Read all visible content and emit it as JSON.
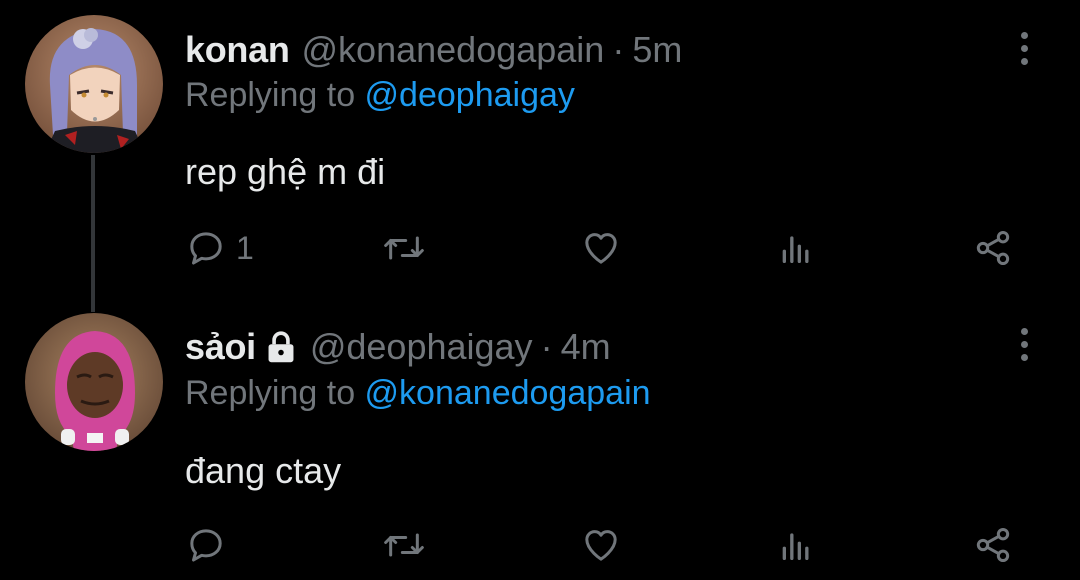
{
  "tweets": [
    {
      "name": "konan",
      "handle": "@konanedogapain",
      "separator": "·",
      "time": "5m",
      "reply_prefix": "Replying to",
      "reply_to": "@deophaigay",
      "text": "rep ghệ m đi",
      "reply_count": "1",
      "protected": false,
      "avatar": "anime-character-avatar"
    },
    {
      "name": "sảoi",
      "handle": "@deophaigay",
      "separator": "·",
      "time": "4m",
      "reply_prefix": "Replying to",
      "reply_to": "@konanedogapain",
      "text": "đang ctay",
      "reply_count": "",
      "protected": true,
      "avatar": "pink-hooded-character-avatar"
    }
  ],
  "colors": {
    "background": "#000000",
    "primary_text": "#e7e9ea",
    "secondary_text": "#71767b",
    "link": "#1d9bf0",
    "thread_line": "#333639"
  },
  "icons": [
    "reply-icon",
    "retweet-icon",
    "like-icon",
    "views-icon",
    "share-icon",
    "more-icon",
    "lock-icon"
  ]
}
